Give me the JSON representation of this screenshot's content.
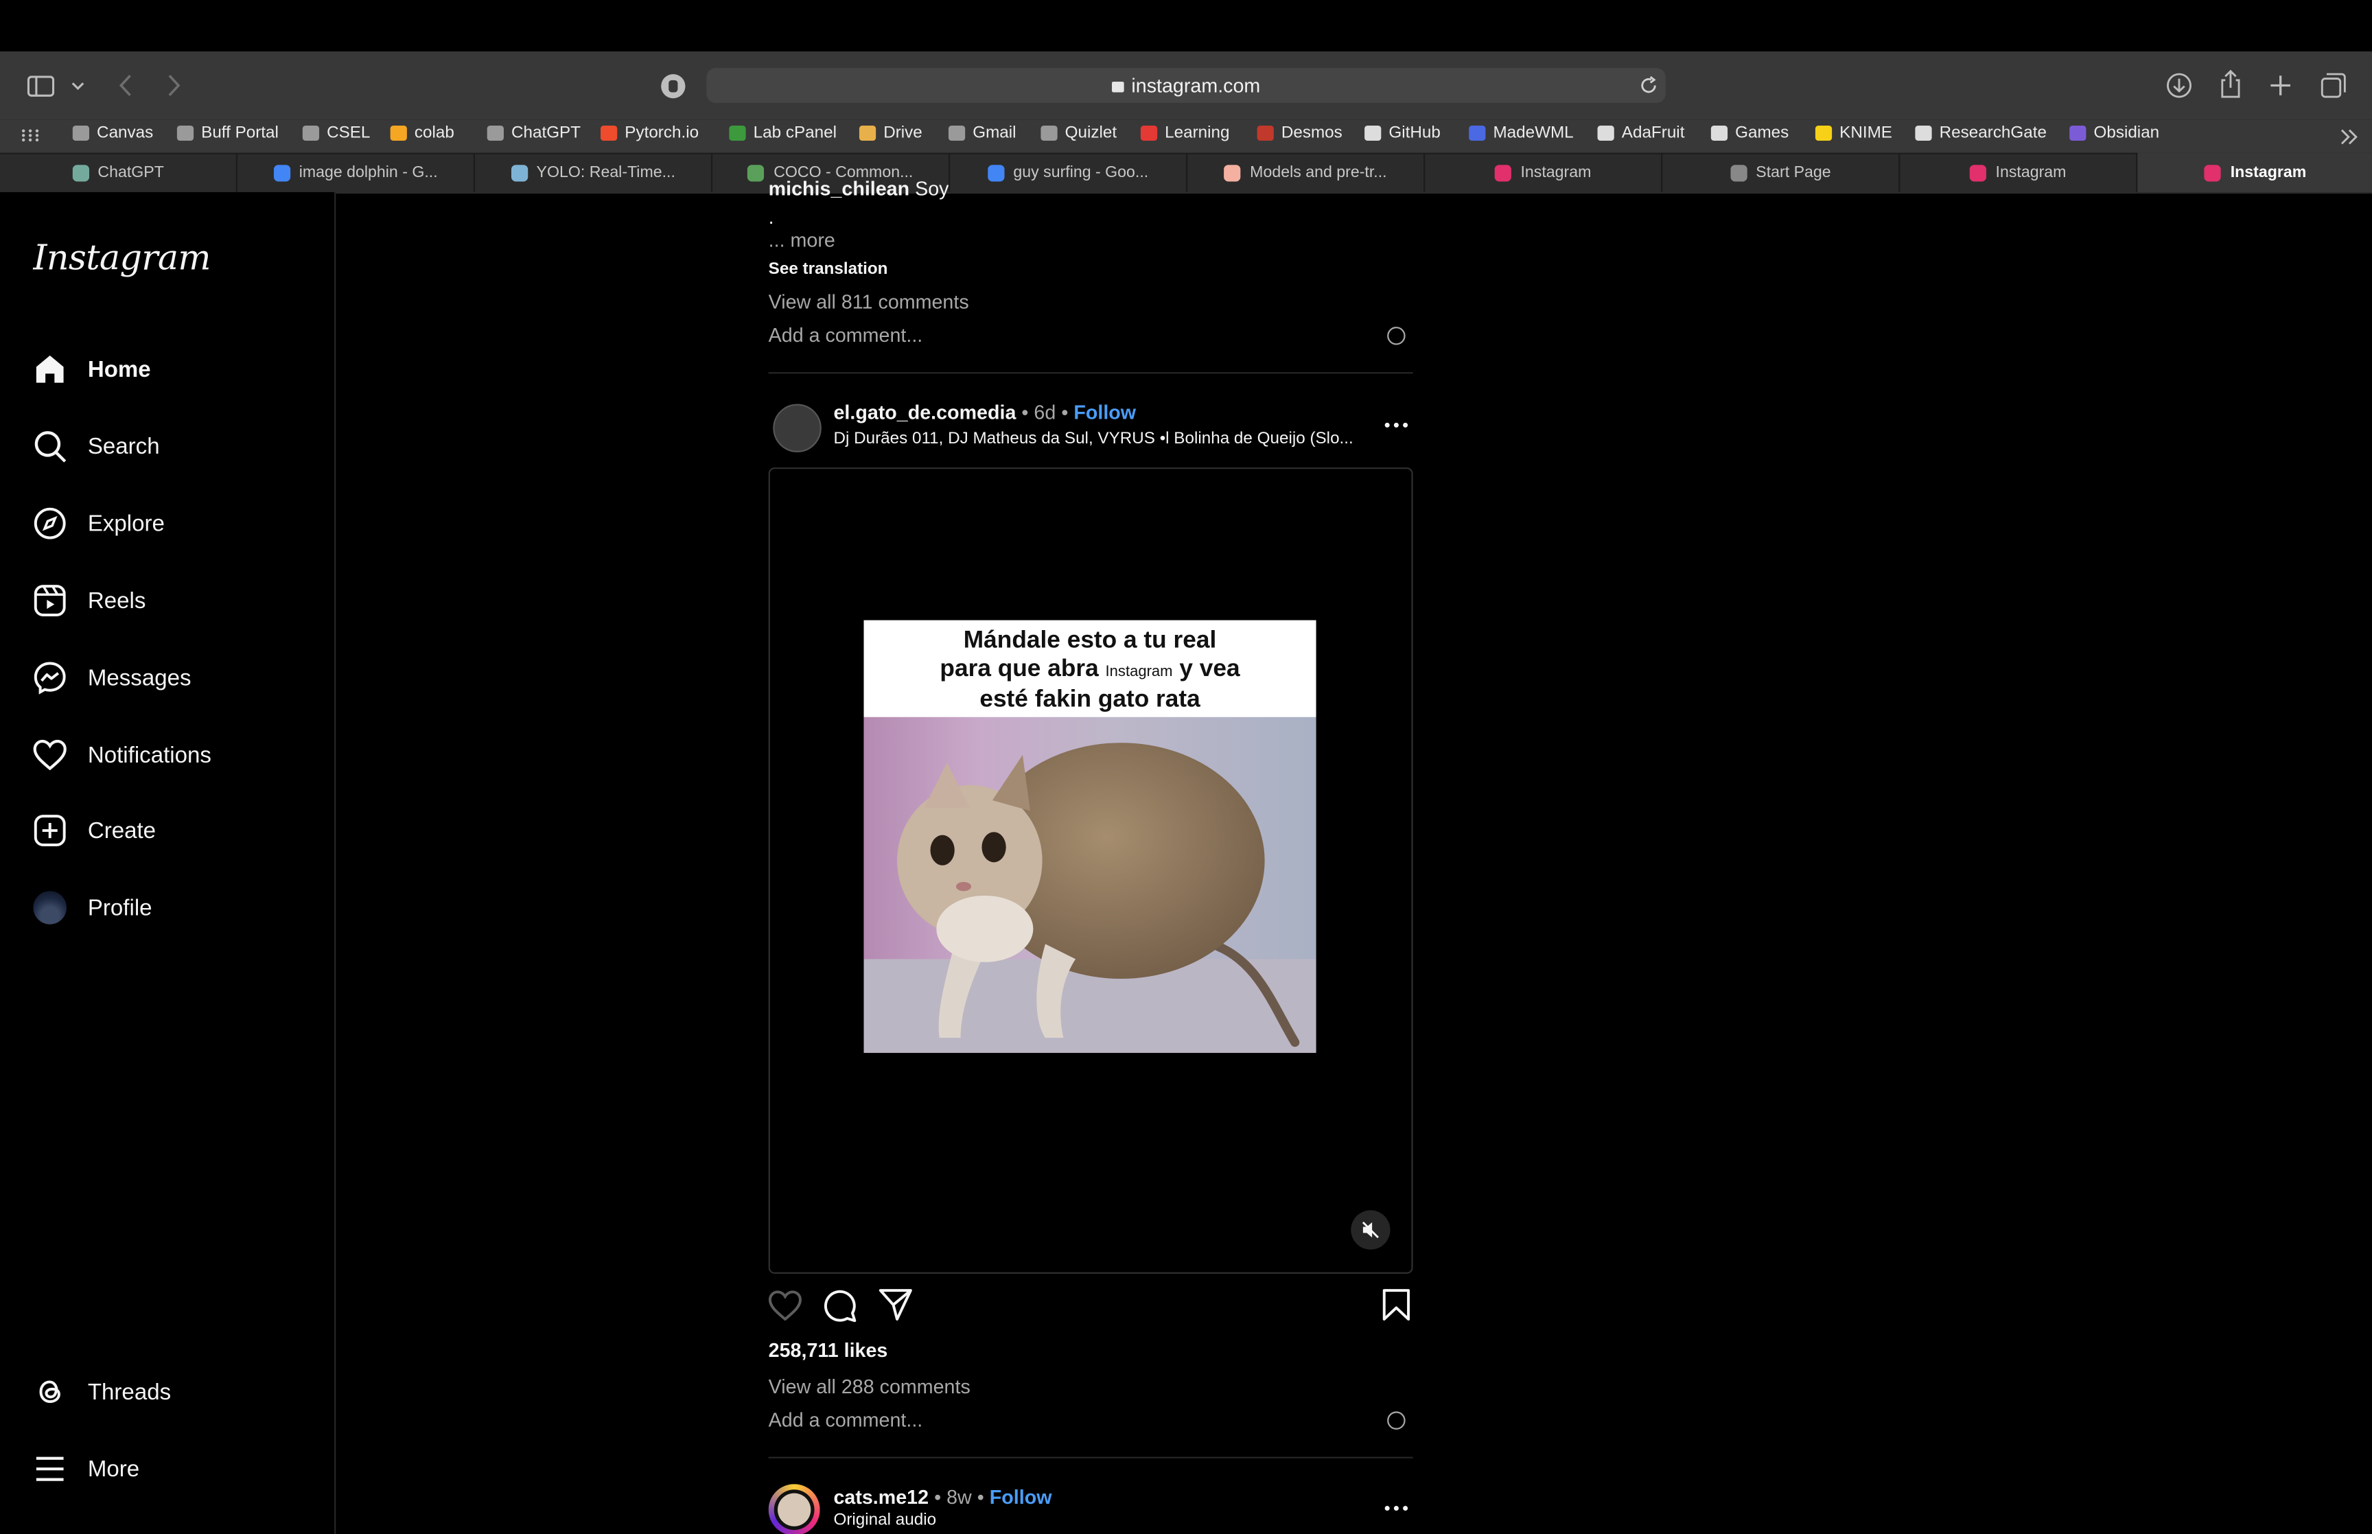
{
  "browser": {
    "url": "instagram.com",
    "bookmarks": [
      {
        "label": "Canvas",
        "color": "#9a9a9a"
      },
      {
        "label": "Buff Portal",
        "color": "#9a9a9a"
      },
      {
        "label": "CSEL",
        "color": "#9a9a9a"
      },
      {
        "label": "colab",
        "color": "#f5a623"
      },
      {
        "label": "ChatGPT",
        "color": "#9a9a9a"
      },
      {
        "label": "Pytorch.io",
        "color": "#ee4c2c"
      },
      {
        "label": "Lab cPanel",
        "color": "#3c9a3c"
      },
      {
        "label": "Drive",
        "color": "#e8b04a"
      },
      {
        "label": "Gmail",
        "color": "#9a9a9a"
      },
      {
        "label": "Quizlet",
        "color": "#9a9a9a"
      },
      {
        "label": "Learning",
        "color": "#e53935"
      },
      {
        "label": "Desmos",
        "color": "#c0392b"
      },
      {
        "label": "GitHub",
        "color": "#dddddd"
      },
      {
        "label": "MadeWML",
        "color": "#4a69e2"
      },
      {
        "label": "AdaFruit",
        "color": "#dddddd"
      },
      {
        "label": "Games",
        "color": "#dddddd"
      },
      {
        "label": "KNIME",
        "color": "#f7d117"
      },
      {
        "label": "ResearchGate",
        "color": "#dddddd"
      },
      {
        "label": "Obsidian",
        "color": "#7c5cd6"
      }
    ],
    "tabs": [
      {
        "label": "ChatGPT",
        "color": "#74aa9c"
      },
      {
        "label": "image dolphin - G...",
        "color": "#4285f4"
      },
      {
        "label": "YOLO: Real-Time...",
        "color": "#7fb3d5"
      },
      {
        "label": "COCO - Common...",
        "color": "#5aa05a"
      },
      {
        "label": "guy surfing - Goo...",
        "color": "#4285f4"
      },
      {
        "label": "Models and pre-tr...",
        "color": "#f4b0a0"
      },
      {
        "label": "Instagram",
        "color": "#e1306c"
      },
      {
        "label": "Start Page",
        "color": "#888888"
      },
      {
        "label": "Instagram",
        "color": "#e1306c"
      },
      {
        "label": "Instagram",
        "color": "#e1306c"
      }
    ]
  },
  "sidebar": {
    "logo": "Instagram",
    "nav": [
      {
        "label": "Home",
        "icon": "home-icon"
      },
      {
        "label": "Search",
        "icon": "search-icon"
      },
      {
        "label": "Explore",
        "icon": "compass-icon"
      },
      {
        "label": "Reels",
        "icon": "reels-icon"
      },
      {
        "label": "Messages",
        "icon": "messenger-icon"
      },
      {
        "label": "Notifications",
        "icon": "heart-icon"
      },
      {
        "label": "Create",
        "icon": "plus-square-icon"
      },
      {
        "label": "Profile",
        "icon": "avatar"
      }
    ],
    "bottom": [
      {
        "label": "Threads",
        "icon": "threads-icon"
      },
      {
        "label": "More",
        "icon": "menu-icon"
      }
    ]
  },
  "prev_post": {
    "username_partial": "michis_chilean",
    "caption_partial": "Soy",
    "dot": ".",
    "more": "... more",
    "see_translation": "See translation",
    "view_comments": "View all 811 comments",
    "add_comment": "Add a comment..."
  },
  "post": {
    "username": "el.gato_de.comedia",
    "sep": "•",
    "age": "6d",
    "follow": "Follow",
    "audio": "Dj Durães 011, DJ Matheus da Sul, VYRUS •l Bolinha de Queijo (Slo...",
    "meme_line1": "Mándale esto a tu real",
    "meme_line2a": "para que abra",
    "meme_inline": "Instagram",
    "meme_line2b": "y vea",
    "meme_line3": "esté fakin gato rata",
    "likes": "258,711 likes",
    "view_comments": "View all 288 comments",
    "add_comment": "Add a comment..."
  },
  "next_post": {
    "username": "cats.me12",
    "sep": "•",
    "age": "8w",
    "follow": "Follow",
    "audio": "Original audio"
  }
}
